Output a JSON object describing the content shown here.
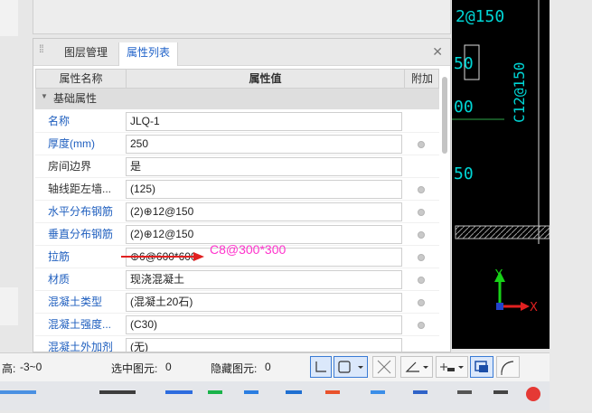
{
  "tabs": {
    "layer": "图层管理",
    "properties": "属性列表"
  },
  "headers": {
    "name": "属性名称",
    "value": "属性值",
    "extra": "附加"
  },
  "group": "基础属性",
  "rows": [
    {
      "name": "名称",
      "value": "JLQ-1",
      "color": "blue",
      "dot": false
    },
    {
      "name": "厚度(mm)",
      "value": "250",
      "color": "blue",
      "dot": true
    },
    {
      "name": "房间边界",
      "value": "是",
      "color": "dark",
      "dot": false
    },
    {
      "name": "轴线距左墙...",
      "value": "(125)",
      "color": "dark",
      "dot": true
    },
    {
      "name": "水平分布钢筋",
      "value": "(2)⊕12@150",
      "color": "blue",
      "dot": true
    },
    {
      "name": "垂直分布钢筋",
      "value": "(2)⊕12@150",
      "color": "blue",
      "dot": true
    },
    {
      "name": "拉筋",
      "value": "⊕6@600*600",
      "color": "blue",
      "dot": true
    },
    {
      "name": "材质",
      "value": "现浇混凝土",
      "color": "blue",
      "dot": true
    },
    {
      "name": "混凝土类型",
      "value": "(混凝土20石)",
      "color": "blue",
      "dot": true
    },
    {
      "name": "混凝土强度...",
      "value": "(C30)",
      "color": "blue",
      "dot": true
    },
    {
      "name": "混凝土外加剂",
      "value": "(无)",
      "color": "blue",
      "dot": false
    }
  ],
  "annotation": "C8@300*300",
  "cad": {
    "labels": [
      "2@150",
      "50",
      "C12@150",
      "00",
      "50"
    ],
    "axis": {
      "y": "Y",
      "x": "X"
    },
    "colors": {
      "text": "#00d6d6",
      "box": "#dddddd",
      "y_axis": "#17d117",
      "x_axis": "#e02020"
    }
  },
  "status": {
    "height_label": "高:",
    "height_value": "-3~0",
    "selected_label": "选中图元:",
    "selected_value": "0",
    "hidden_label": "隐藏图元:",
    "hidden_value": "0"
  }
}
